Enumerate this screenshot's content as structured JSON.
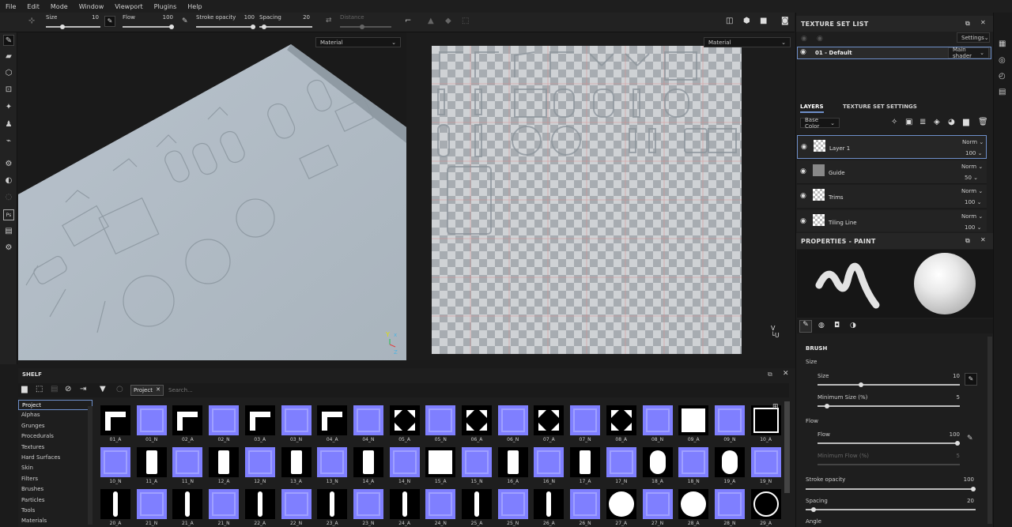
{
  "menu": [
    "File",
    "Edit",
    "Mode",
    "Window",
    "Viewport",
    "Plugins",
    "Help"
  ],
  "toolbar": {
    "size_label": "Size",
    "size_value": "10",
    "flow_label": "Flow",
    "flow_value": "100",
    "stroke_opacity_label": "Stroke opacity",
    "stroke_opacity_value": "100",
    "spacing_label": "Spacing",
    "spacing_value": "20",
    "distance_label": "Distance"
  },
  "viewport3d": {
    "channel": "Material"
  },
  "viewport2d": {
    "channel": "Material"
  },
  "texture_set_list": {
    "title": "TEXTURE SET LIST",
    "settings_label": "Settings",
    "item_name": "01 - Default",
    "shader": "Main shader"
  },
  "layers_panel": {
    "tab_layers": "LAYERS",
    "tab_settings": "TEXTURE SET SETTINGS",
    "channel": "Base Color",
    "layers": [
      {
        "name": "Layer 1",
        "blend": "Norm",
        "opacity": "100"
      },
      {
        "name": "Guide",
        "blend": "Norm",
        "opacity": "50"
      },
      {
        "name": "Trims",
        "blend": "Norm",
        "opacity": "100"
      },
      {
        "name": "Tiling Line",
        "blend": "Norm",
        "opacity": "100"
      }
    ]
  },
  "properties": {
    "title": "PROPERTIES - PAINT",
    "brush_header": "BRUSH",
    "size_section": "Size",
    "size_label": "Size",
    "size_value": "10",
    "min_size_label": "Minimum Size (%)",
    "min_size_value": "5",
    "flow_section": "Flow",
    "flow_label": "Flow",
    "flow_value": "100",
    "min_flow_label": "Minimum Flow (%)",
    "min_flow_value": "5",
    "stroke_opacity_label": "Stroke opacity",
    "stroke_opacity_value": "100",
    "spacing_label": "Spacing",
    "spacing_value": "20",
    "angle_label": "Angle"
  },
  "shelf": {
    "title": "SHELF",
    "filter_tag": "Project",
    "search_placeholder": "Search...",
    "categories": [
      "Project",
      "Alphas",
      "Grunges",
      "Procedurals",
      "Textures",
      "Hard Surfaces",
      "Skin",
      "Filters",
      "Brushes",
      "Particles",
      "Tools",
      "Materials"
    ],
    "rows": [
      [
        "01_A",
        "01_N",
        "02_A",
        "02_N",
        "03_A",
        "03_N",
        "04_A",
        "04_N",
        "05_A",
        "05_N",
        "06_A",
        "06_N",
        "07_A",
        "07_N",
        "08_A",
        "08_N",
        "09_A",
        "09_N",
        "10_A"
      ],
      [
        "10_N",
        "11_A",
        "11_N",
        "12_A",
        "12_N",
        "13_A",
        "13_N",
        "14_A",
        "14_N",
        "15_A",
        "15_N",
        "16_A",
        "16_N",
        "17_A",
        "17_N",
        "18_A",
        "18_N",
        "19_A",
        "19_N"
      ],
      [
        "20_A",
        "21_N",
        "21_A",
        "21_N",
        "22_A",
        "22_N",
        "23_A",
        "23_N",
        "24_A",
        "24_N",
        "25_A",
        "25_N",
        "26_A",
        "26_N",
        "27_A",
        "27_N",
        "28_A",
        "28_N",
        "29_A"
      ]
    ]
  }
}
